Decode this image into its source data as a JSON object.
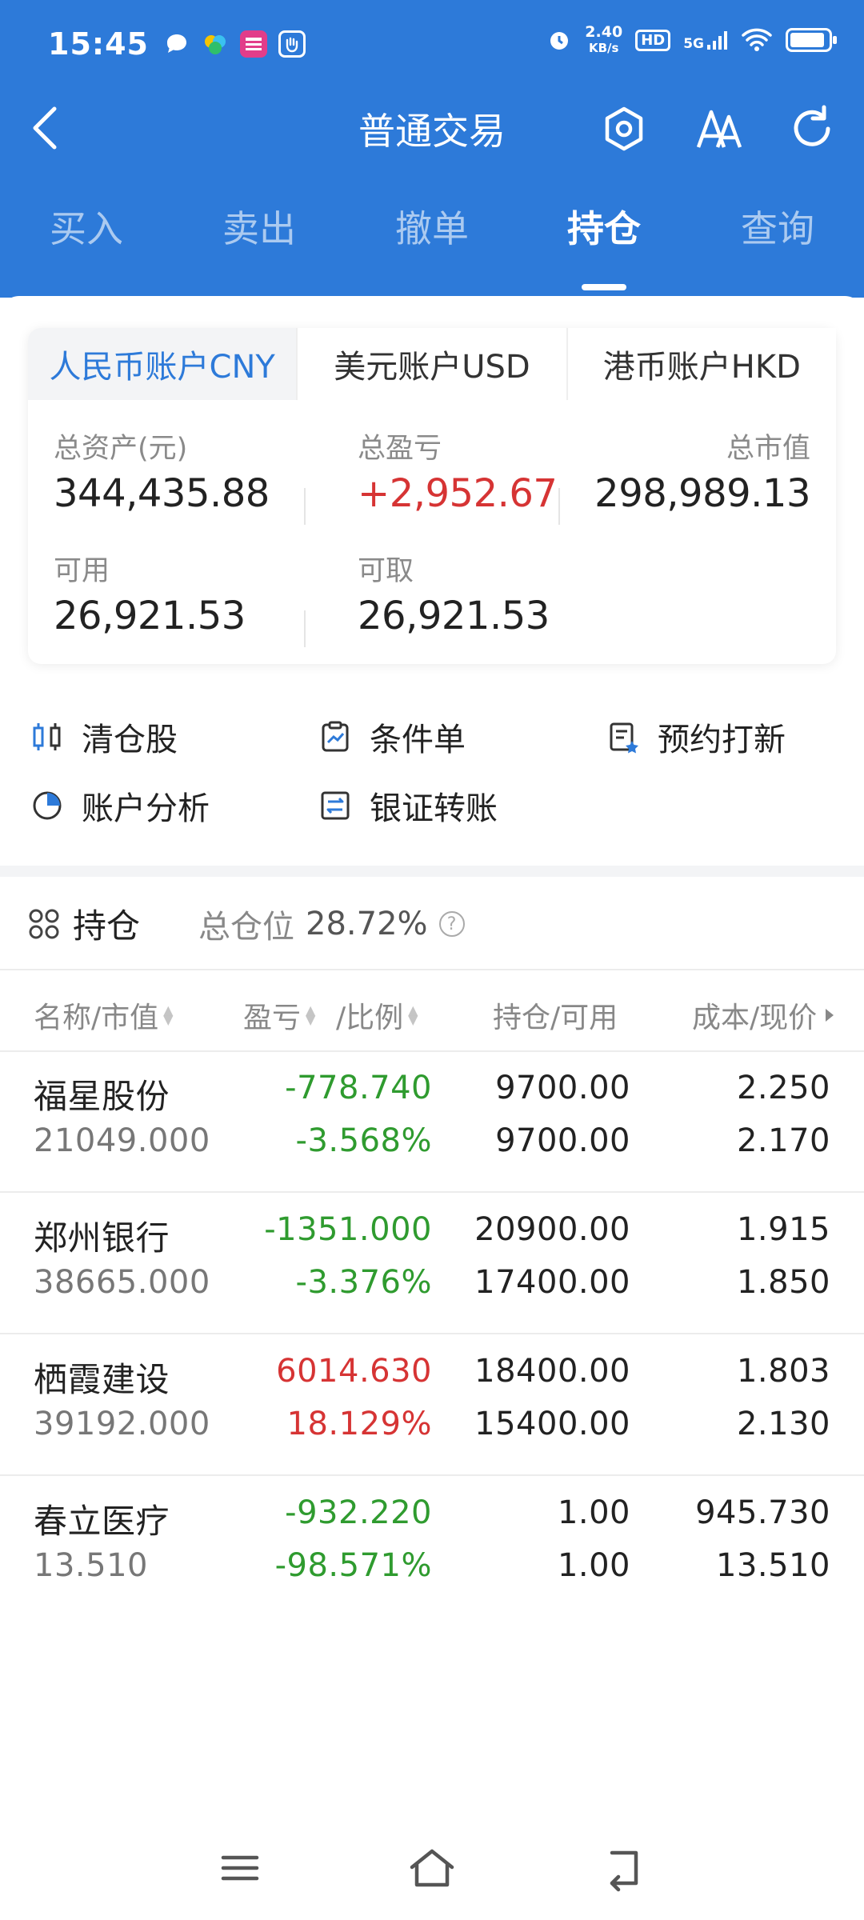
{
  "status_bar": {
    "time": "15:45",
    "net_speed_value": "2.40",
    "net_speed_unit": "KB/s",
    "hd": "HD",
    "signal": "5G"
  },
  "nav": {
    "title": "普通交易"
  },
  "tabs": [
    {
      "label": "买入"
    },
    {
      "label": "卖出"
    },
    {
      "label": "撤单"
    },
    {
      "label": "持仓",
      "active": true
    },
    {
      "label": "查询"
    }
  ],
  "account_tabs": [
    {
      "label": "人民币账户CNY",
      "active": true
    },
    {
      "label": "美元账户USD"
    },
    {
      "label": "港币账户HKD"
    }
  ],
  "summary": {
    "total_assets_label": "总资产(元)",
    "total_assets": "344,435.88",
    "total_pl_label": "总盈亏",
    "total_pl": "+2,952.67",
    "market_value_label": "总市值",
    "market_value": "298,989.13",
    "available_label": "可用",
    "available": "26,921.53",
    "withdrawable_label": "可取",
    "withdrawable": "26,921.53"
  },
  "quick_actions": [
    {
      "label": "清仓股",
      "icon": "clear-position-icon"
    },
    {
      "label": "条件单",
      "icon": "conditional-order-icon"
    },
    {
      "label": "预约打新",
      "icon": "ipo-reserve-icon"
    },
    {
      "label": "账户分析",
      "icon": "pie-chart-icon"
    },
    {
      "label": "银证转账",
      "icon": "transfer-icon"
    }
  ],
  "holdings": {
    "title": "持仓",
    "ratio_label": "总仓位",
    "ratio_value": "28.72%",
    "columns": [
      "名称/市值",
      "盈亏",
      "/比例",
      "持仓/可用",
      "成本/现价"
    ],
    "rows": [
      {
        "name": "福星股份",
        "market_value": "21049.000",
        "pl": "-778.740",
        "pct": "-3.568%",
        "hold": "9700.00",
        "avail": "9700.00",
        "cost": "2.250",
        "price": "2.170",
        "color": "#2f9b2f"
      },
      {
        "name": "郑州银行",
        "market_value": "38665.000",
        "pl": "-1351.000",
        "pct": "-3.376%",
        "hold": "20900.00",
        "avail": "17400.00",
        "cost": "1.915",
        "price": "1.850",
        "color": "#2f9b2f"
      },
      {
        "name": "栖霞建设",
        "market_value": "39192.000",
        "pl": "6014.630",
        "pct": "18.129%",
        "hold": "18400.00",
        "avail": "15400.00",
        "cost": "1.803",
        "price": "2.130",
        "color": "#d63434"
      },
      {
        "name": "春立医疗",
        "market_value": "13.510",
        "pl": "-932.220",
        "pct": "-98.571%",
        "hold": "1.00",
        "avail": "1.00",
        "cost": "945.730",
        "price": "13.510",
        "color": "#2f9b2f"
      }
    ]
  },
  "colors": {
    "brand": "#2d7ad9",
    "up": "#d63434",
    "down": "#2f9b2f"
  }
}
